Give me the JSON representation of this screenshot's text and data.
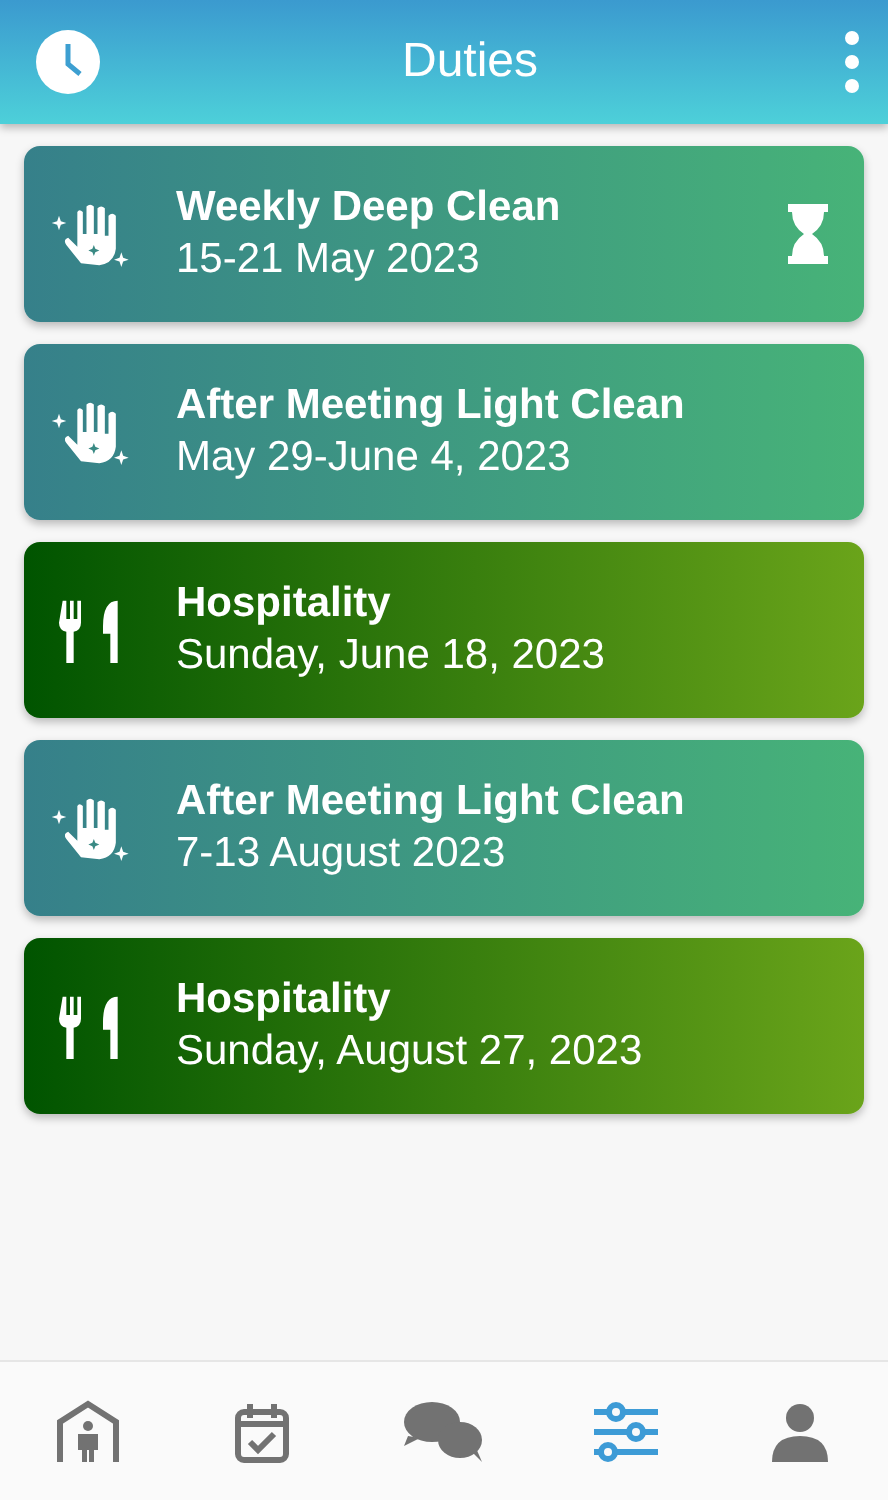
{
  "app_bar": {
    "title": "Duties"
  },
  "duties": [
    {
      "kind": "cleaning",
      "title": "Weekly Deep Clean",
      "date": "15-21 May 2023",
      "pending": true
    },
    {
      "kind": "cleaning",
      "title": "After Meeting Light Clean",
      "date": "May 29-June 4, 2023",
      "pending": false
    },
    {
      "kind": "hospitality",
      "title": "Hospitality",
      "date": "Sunday, June 18, 2023",
      "pending": false
    },
    {
      "kind": "cleaning",
      "title": "After Meeting Light Clean",
      "date": "7-13 August 2023",
      "pending": false
    },
    {
      "kind": "hospitality",
      "title": "Hospitality",
      "date": "Sunday, August 27, 2023",
      "pending": false
    }
  ],
  "bottom_nav": [
    {
      "kind": "home",
      "selected": false
    },
    {
      "kind": "calendar",
      "selected": false
    },
    {
      "kind": "chat",
      "selected": false
    },
    {
      "kind": "settings",
      "selected": true
    },
    {
      "kind": "profile",
      "selected": false
    }
  ]
}
